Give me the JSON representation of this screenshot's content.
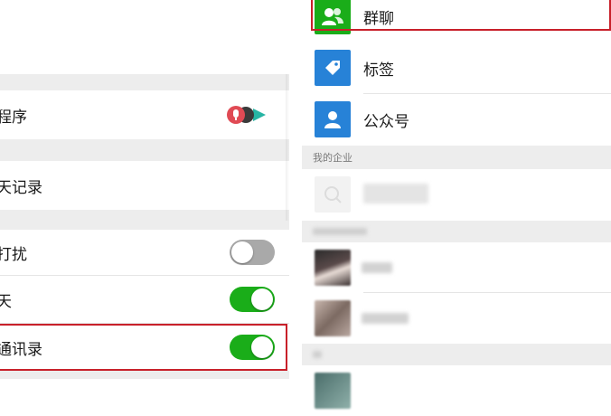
{
  "settings": {
    "items": [
      {
        "label": "程序"
      },
      {
        "label": "天记录"
      },
      {
        "label": "打扰",
        "toggle": "off"
      },
      {
        "label": "天",
        "toggle": "on"
      },
      {
        "label": "通讯录",
        "toggle": "on"
      }
    ]
  },
  "contacts": {
    "entries": [
      {
        "label": "群聊",
        "icon": "group-chat-icon",
        "color": "#1aad19"
      },
      {
        "label": "标签",
        "icon": "tag-icon",
        "color": "#2782d7"
      },
      {
        "label": "公众号",
        "icon": "official-account-icon",
        "color": "#2782d7"
      }
    ],
    "section_enterprise": "我的企业"
  },
  "colors": {
    "highlight": "#c8202a",
    "toggle_on": "#1aad19",
    "toggle_off": "#a9a9a9",
    "background_gap": "#ededed"
  }
}
